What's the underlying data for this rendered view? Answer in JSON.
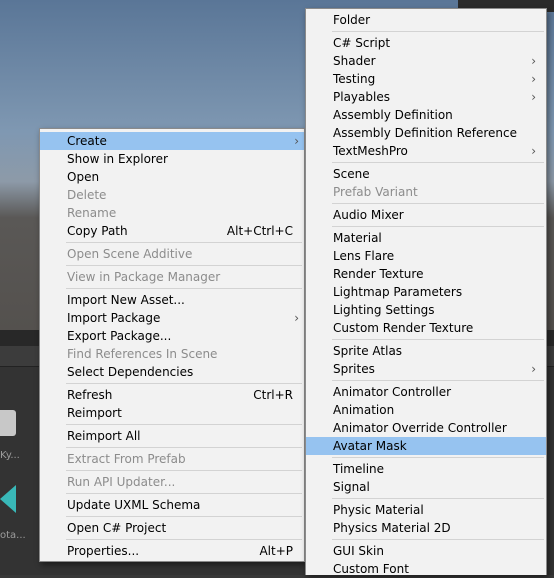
{
  "context_menu": {
    "items": [
      {
        "label": "Create",
        "shortcut": "",
        "submenu": true,
        "enabled": true,
        "highlighted": true
      },
      {
        "label": "Show in Explorer",
        "shortcut": "",
        "submenu": false,
        "enabled": true
      },
      {
        "label": "Open",
        "shortcut": "",
        "submenu": false,
        "enabled": true
      },
      {
        "label": "Delete",
        "shortcut": "",
        "submenu": false,
        "enabled": false
      },
      {
        "label": "Rename",
        "shortcut": "",
        "submenu": false,
        "enabled": false
      },
      {
        "label": "Copy Path",
        "shortcut": "Alt+Ctrl+C",
        "submenu": false,
        "enabled": true
      },
      {
        "label": "Open Scene Additive",
        "shortcut": "",
        "submenu": false,
        "enabled": false
      },
      {
        "label": "View in Package Manager",
        "shortcut": "",
        "submenu": false,
        "enabled": false
      },
      {
        "label": "Import New Asset...",
        "shortcut": "",
        "submenu": false,
        "enabled": true
      },
      {
        "label": "Import Package",
        "shortcut": "",
        "submenu": true,
        "enabled": true
      },
      {
        "label": "Export Package...",
        "shortcut": "",
        "submenu": false,
        "enabled": true
      },
      {
        "label": "Find References In Scene",
        "shortcut": "",
        "submenu": false,
        "enabled": false
      },
      {
        "label": "Select Dependencies",
        "shortcut": "",
        "submenu": false,
        "enabled": true
      },
      {
        "label": "Refresh",
        "shortcut": "Ctrl+R",
        "submenu": false,
        "enabled": true
      },
      {
        "label": "Reimport",
        "shortcut": "",
        "submenu": false,
        "enabled": true
      },
      {
        "label": "Reimport All",
        "shortcut": "",
        "submenu": false,
        "enabled": true
      },
      {
        "label": "Extract From Prefab",
        "shortcut": "",
        "submenu": false,
        "enabled": false
      },
      {
        "label": "Run API Updater...",
        "shortcut": "",
        "submenu": false,
        "enabled": false
      },
      {
        "label": "Update UXML Schema",
        "shortcut": "",
        "submenu": false,
        "enabled": true
      },
      {
        "label": "Open C# Project",
        "shortcut": "",
        "submenu": false,
        "enabled": true
      },
      {
        "label": "Properties...",
        "shortcut": "Alt+P",
        "submenu": false,
        "enabled": true
      }
    ]
  },
  "create_submenu": {
    "items": [
      {
        "label": "Folder",
        "submenu": false,
        "enabled": true
      },
      {
        "label": "C# Script",
        "submenu": false,
        "enabled": true
      },
      {
        "label": "Shader",
        "submenu": true,
        "enabled": true
      },
      {
        "label": "Testing",
        "submenu": true,
        "enabled": true
      },
      {
        "label": "Playables",
        "submenu": true,
        "enabled": true
      },
      {
        "label": "Assembly Definition",
        "submenu": false,
        "enabled": true
      },
      {
        "label": "Assembly Definition Reference",
        "submenu": false,
        "enabled": true
      },
      {
        "label": "TextMeshPro",
        "submenu": true,
        "enabled": true
      },
      {
        "label": "Scene",
        "submenu": false,
        "enabled": true
      },
      {
        "label": "Prefab Variant",
        "submenu": false,
        "enabled": false
      },
      {
        "label": "Audio Mixer",
        "submenu": false,
        "enabled": true
      },
      {
        "label": "Material",
        "submenu": false,
        "enabled": true
      },
      {
        "label": "Lens Flare",
        "submenu": false,
        "enabled": true
      },
      {
        "label": "Render Texture",
        "submenu": false,
        "enabled": true
      },
      {
        "label": "Lightmap Parameters",
        "submenu": false,
        "enabled": true
      },
      {
        "label": "Lighting Settings",
        "submenu": false,
        "enabled": true
      },
      {
        "label": "Custom Render Texture",
        "submenu": false,
        "enabled": true
      },
      {
        "label": "Sprite Atlas",
        "submenu": false,
        "enabled": true
      },
      {
        "label": "Sprites",
        "submenu": true,
        "enabled": true
      },
      {
        "label": "Animator Controller",
        "submenu": false,
        "enabled": true
      },
      {
        "label": "Animation",
        "submenu": false,
        "enabled": true
      },
      {
        "label": "Animator Override Controller",
        "submenu": false,
        "enabled": true
      },
      {
        "label": "Avatar Mask",
        "submenu": false,
        "enabled": true,
        "highlighted": true
      },
      {
        "label": "Timeline",
        "submenu": false,
        "enabled": true
      },
      {
        "label": "Signal",
        "submenu": false,
        "enabled": true
      },
      {
        "label": "Physic Material",
        "submenu": false,
        "enabled": true
      },
      {
        "label": "Physics Material 2D",
        "submenu": false,
        "enabled": true
      },
      {
        "label": "GUI Skin",
        "submenu": false,
        "enabled": true
      },
      {
        "label": "Custom Font",
        "submenu": false,
        "enabled": true
      }
    ]
  },
  "background": {
    "asset_label_1": "Ky...",
    "asset_label_2": "ota..."
  },
  "colors": {
    "menu_bg": "#f2f2f2",
    "highlight": "#96c3f0",
    "disabled_text": "#8c8c8c",
    "teal_asset": "#39b8b8"
  }
}
